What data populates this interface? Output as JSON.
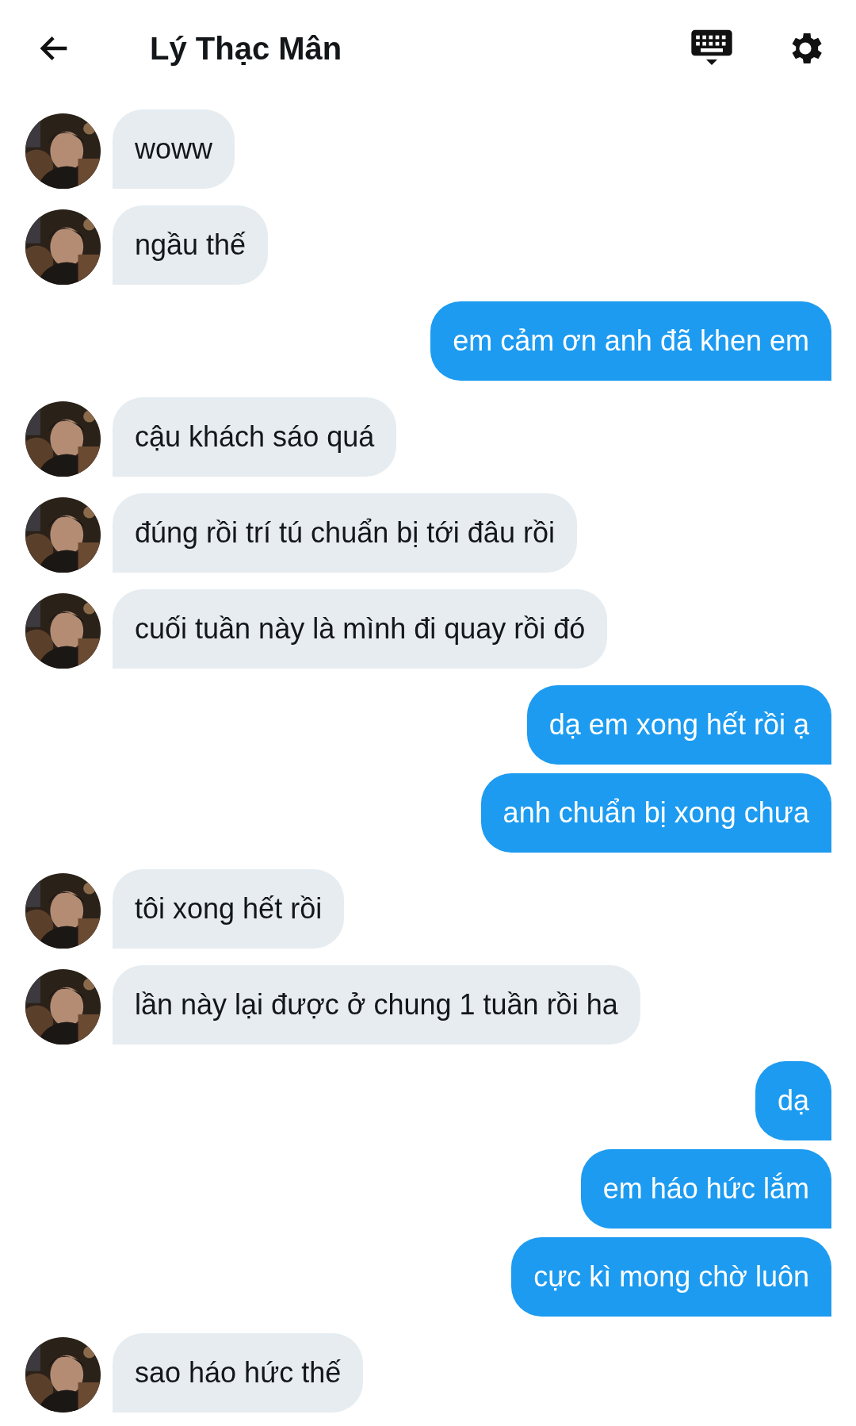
{
  "header": {
    "title": "Lý Thạc Mân"
  },
  "messages": [
    {
      "kind": "incoming",
      "text": "woww"
    },
    {
      "kind": "incoming",
      "text": "ngầu thế"
    },
    {
      "kind": "outgoing",
      "text": "em cảm ơn anh đã khen em"
    },
    {
      "kind": "incoming",
      "text": "cậu khách sáo quá"
    },
    {
      "kind": "incoming",
      "text": "đúng rồi trí tú chuẩn bị tới đâu rồi"
    },
    {
      "kind": "incoming",
      "text": "cuối tuần này là mình đi quay rồi đó"
    },
    {
      "kind": "outgoing",
      "text": "dạ em xong hết rồi ạ"
    },
    {
      "kind": "outgoing",
      "text": "anh chuẩn bị xong chưa"
    },
    {
      "kind": "incoming",
      "text": "tôi xong hết rồi"
    },
    {
      "kind": "incoming",
      "text": "lần này lại được ở chung 1 tuần rồi ha"
    },
    {
      "kind": "outgoing",
      "text": "dạ"
    },
    {
      "kind": "outgoing",
      "text": "em háo hức lắm"
    },
    {
      "kind": "outgoing",
      "text": "cực kì mong chờ luôn"
    },
    {
      "kind": "incoming",
      "text": "sao háo hức thế"
    }
  ]
}
